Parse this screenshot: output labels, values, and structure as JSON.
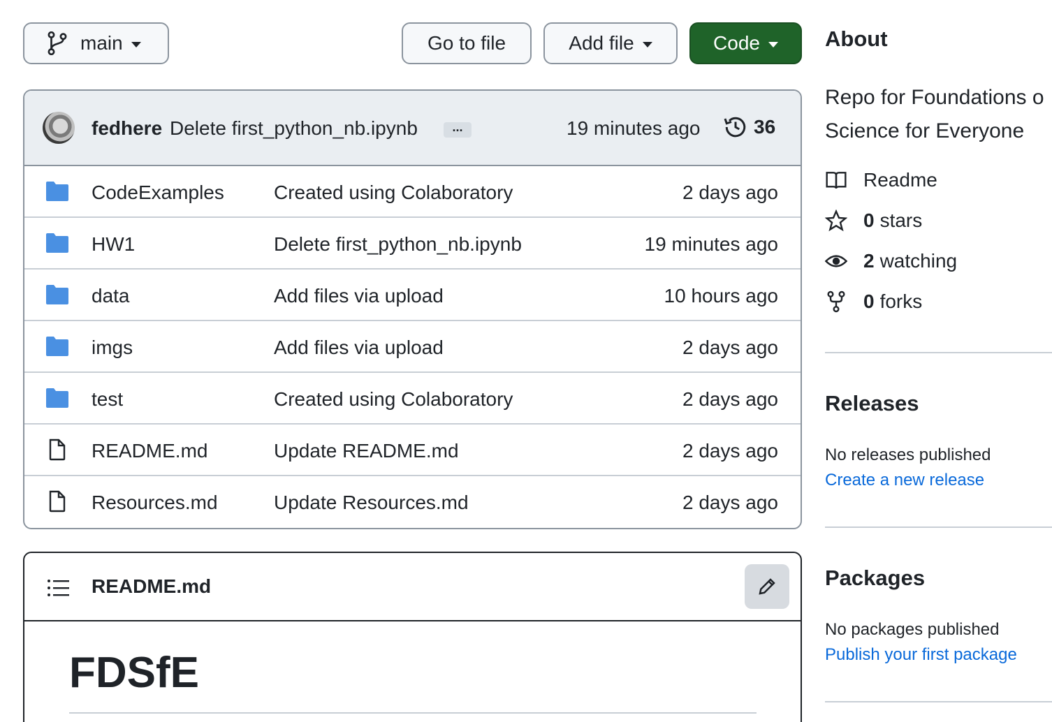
{
  "toolbar": {
    "branch": "main",
    "go_to_file": "Go to file",
    "add_file": "Add file",
    "code": "Code"
  },
  "latest_commit": {
    "author": "fedhere",
    "message": "Delete first_python_nb.ipynb",
    "ellipsis": "...",
    "time": "19 minutes ago",
    "commit_count": "36"
  },
  "files": [
    {
      "type": "folder",
      "name": "CodeExamples",
      "commit": "Created using Colaboratory",
      "time": "2 days ago"
    },
    {
      "type": "folder",
      "name": "HW1",
      "commit": "Delete first_python_nb.ipynb",
      "time": "19 minutes ago"
    },
    {
      "type": "folder",
      "name": "data",
      "commit": "Add files via upload",
      "time": "10 hours ago"
    },
    {
      "type": "folder",
      "name": "imgs",
      "commit": "Add files via upload",
      "time": "2 days ago"
    },
    {
      "type": "folder",
      "name": "test",
      "commit": "Created using Colaboratory",
      "time": "2 days ago"
    },
    {
      "type": "file",
      "name": "README.md",
      "commit": "Update README.md",
      "time": "2 days ago"
    },
    {
      "type": "file",
      "name": "Resources.md",
      "commit": "Update Resources.md",
      "time": "2 days ago"
    }
  ],
  "readme": {
    "filename": "README.md",
    "heading": "FDSfE"
  },
  "about": {
    "title": "About",
    "description_line1": "Repo for Foundations o",
    "description_line2": "Science for Everyone",
    "readme_label": "Readme",
    "stars_count": "0",
    "stars_label": "stars",
    "watching_count": "2",
    "watching_label": "watching",
    "forks_count": "0",
    "forks_label": "forks"
  },
  "releases": {
    "title": "Releases",
    "text": "No releases published",
    "link": "Create a new release"
  },
  "packages": {
    "title": "Packages",
    "text": "No packages published",
    "link": "Publish your first package"
  },
  "colors": {
    "code_button": "#1f6329",
    "folder_icon": "#4a90e2",
    "link": "#0969da"
  }
}
